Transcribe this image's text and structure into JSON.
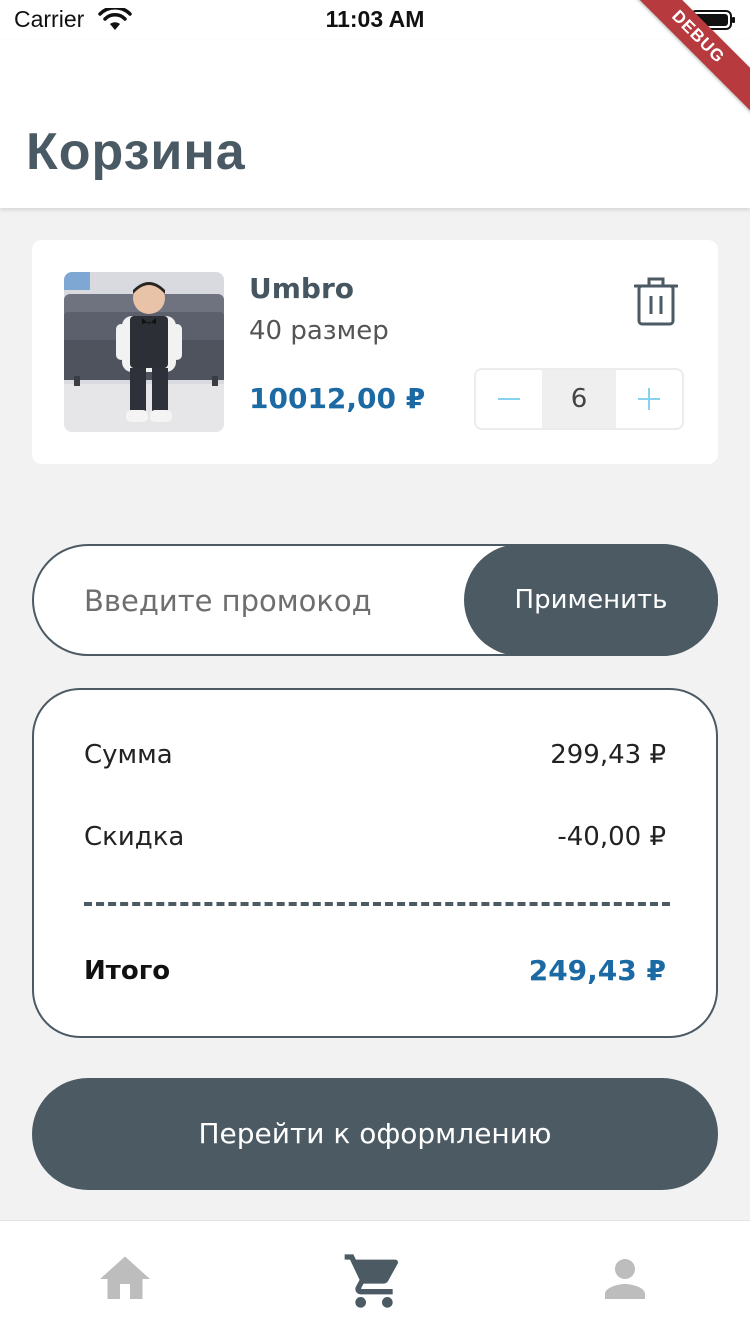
{
  "status_bar": {
    "carrier": "Carrier",
    "time": "11:03 AM",
    "debug_label": "DEBUG"
  },
  "header": {
    "title": "Корзина"
  },
  "cart": {
    "items": [
      {
        "brand": "Umbro",
        "size": "40 размер",
        "price": "10012,00 ₽",
        "quantity": "6",
        "image_icon": "product-photo-child-suit"
      }
    ]
  },
  "promo": {
    "placeholder": "Введите промокод",
    "value": "",
    "apply_label": "Применить"
  },
  "summary": {
    "sum_label": "Сумма",
    "sum_value": "299,43 ₽",
    "discount_label": "Скидка",
    "discount_value": "-40,00 ₽",
    "total_label": "Итого",
    "total_value": "249,43 ₽"
  },
  "checkout": {
    "label": "Перейти к оформлению"
  },
  "nav": {
    "items": [
      {
        "icon": "home-icon",
        "active": false
      },
      {
        "icon": "cart-icon",
        "active": true
      },
      {
        "icon": "profile-icon",
        "active": false
      }
    ]
  },
  "colors": {
    "accent": "#4b5a63",
    "price": "#1c6aa3",
    "stepper": "#87d2ef",
    "background": "#f2f2f2"
  }
}
